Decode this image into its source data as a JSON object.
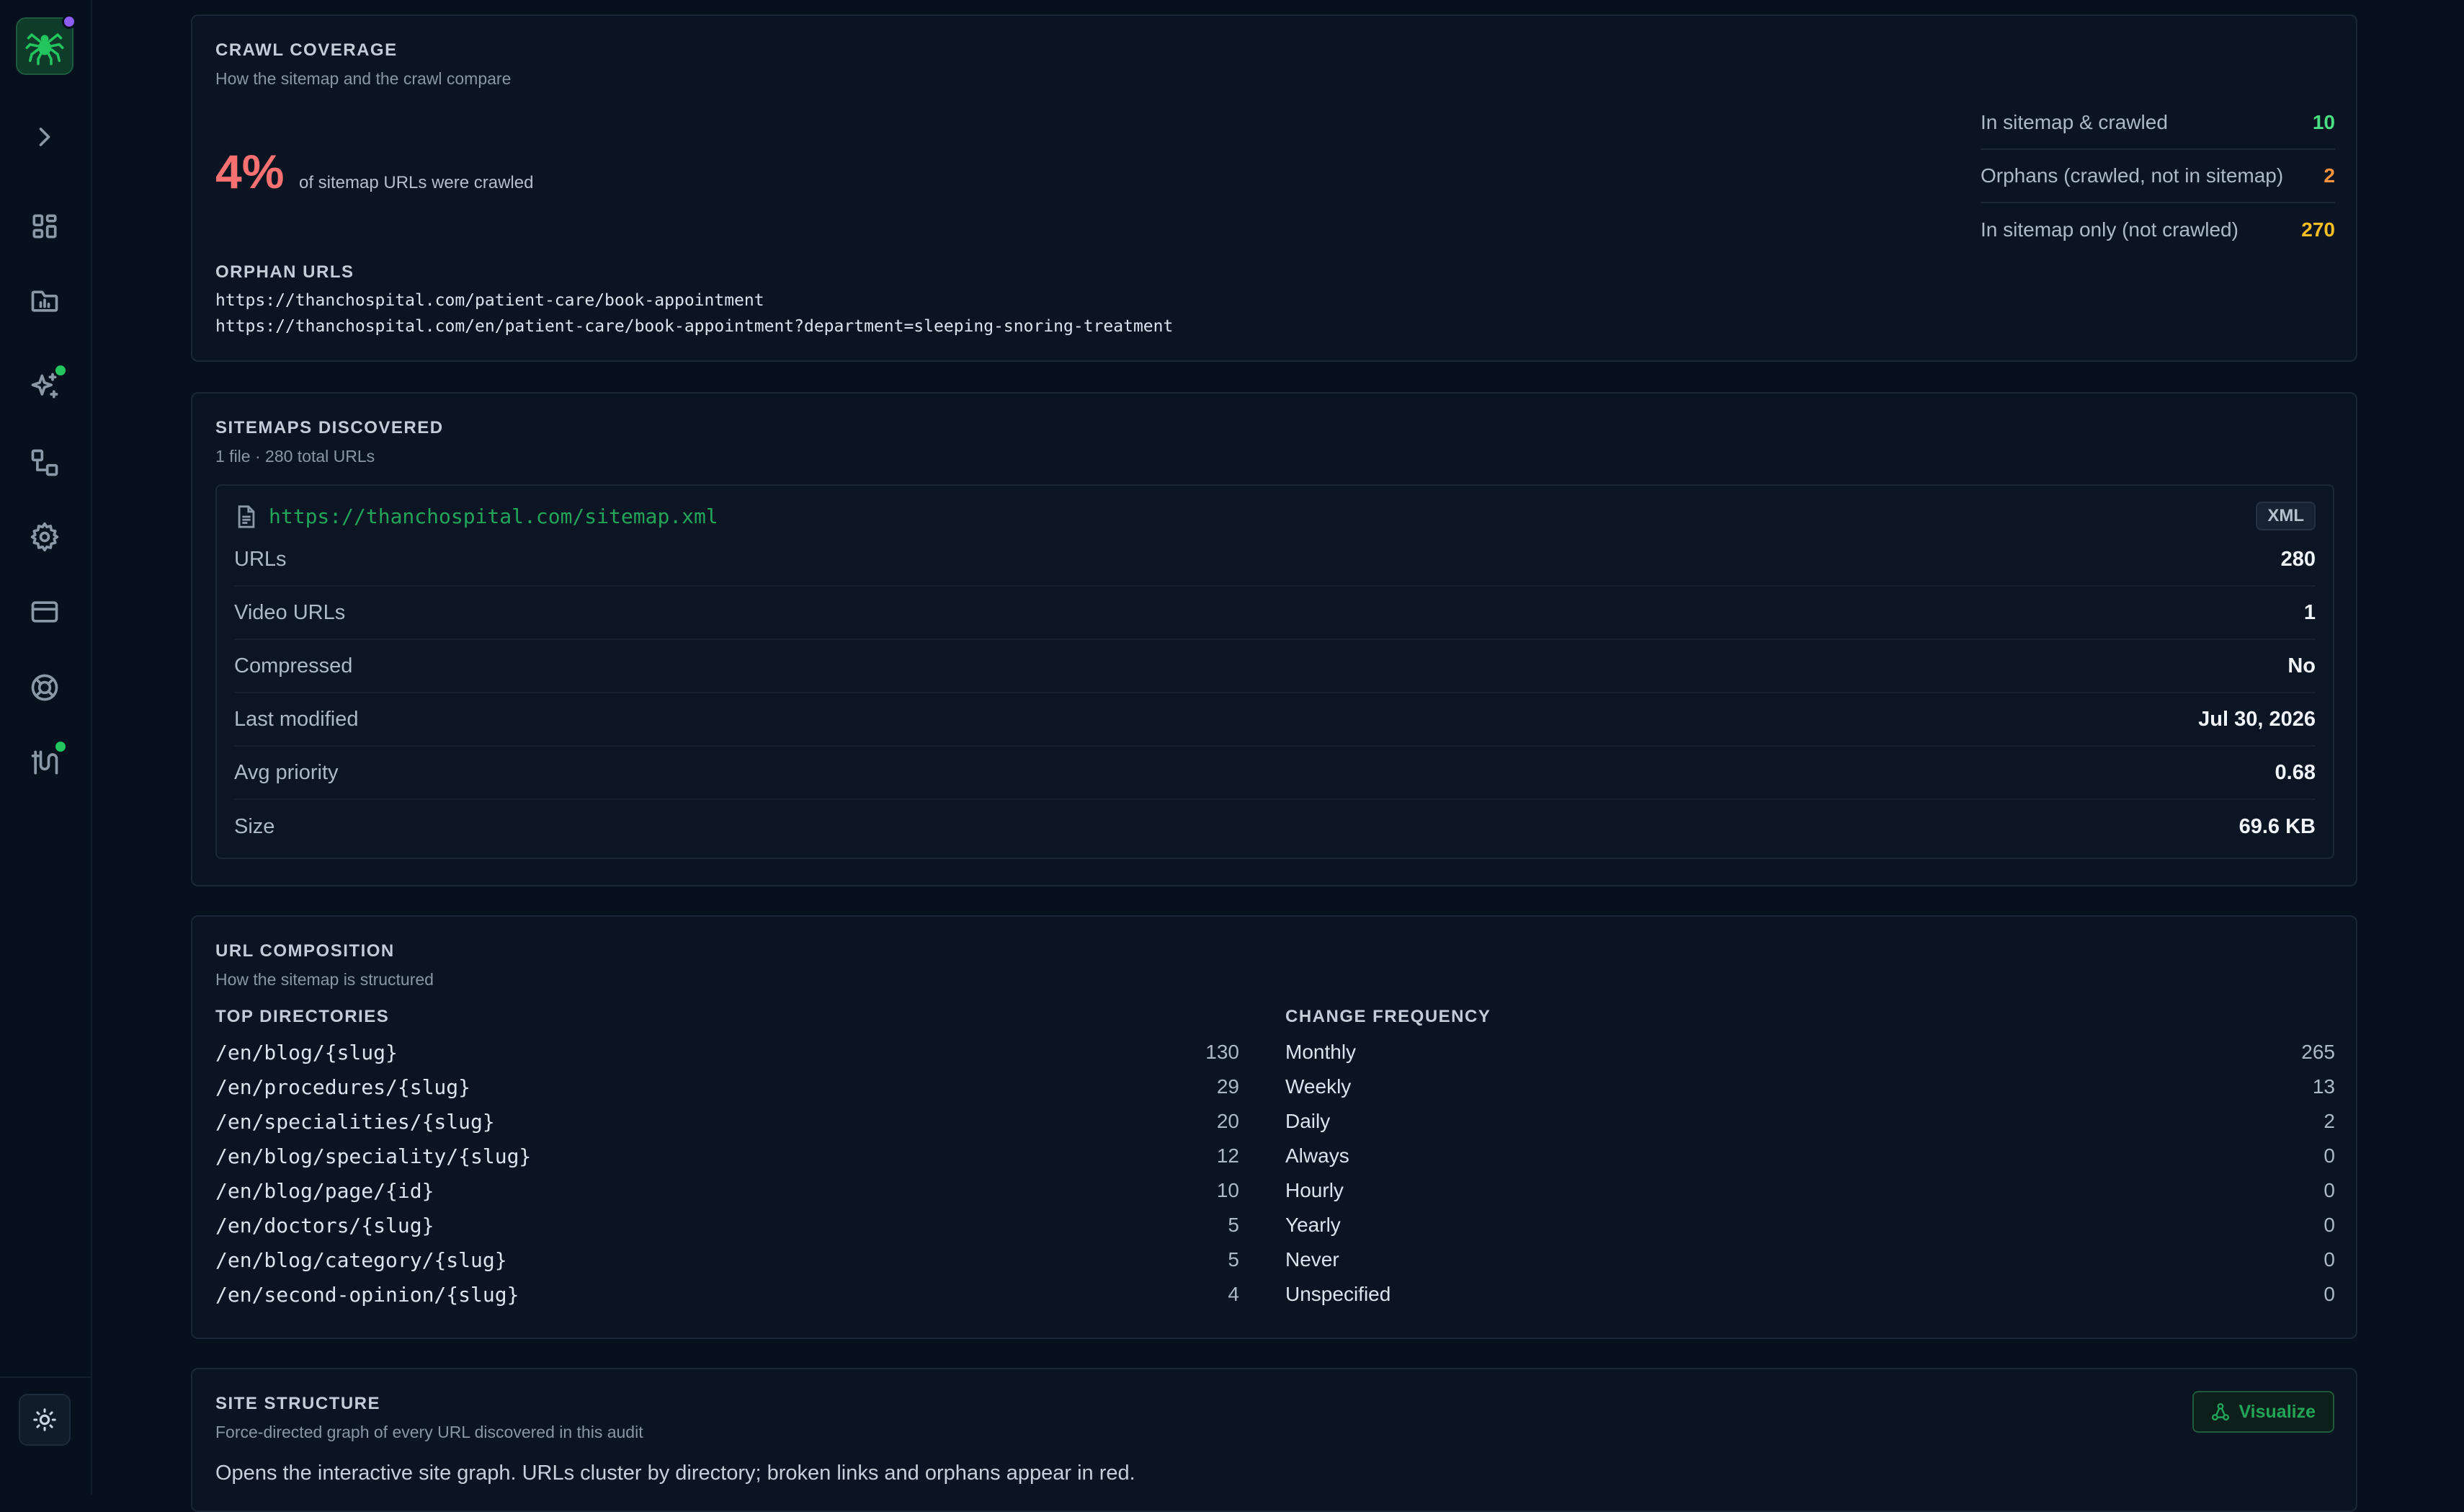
{
  "colors": {
    "accent_green": "#22a559",
    "red": "#f87171",
    "orange": "#fb923c",
    "yellow": "#fbbf24",
    "green_value": "#4ade80"
  },
  "sidebar": {
    "logo": "spider-logo",
    "items": [
      "chevron-right-icon",
      "dashboard-icon",
      "folder-chart-icon",
      "sparkles-icon",
      "workflow-icon",
      "gear-icon",
      "credit-card-icon",
      "lifebuoy-icon",
      "integrations-icon"
    ],
    "theme_toggle": "sun-icon"
  },
  "coverage": {
    "title": "CRAWL COVERAGE",
    "subtitle": "How the sitemap and the crawl compare",
    "percent": "4%",
    "percent_desc": "of sitemap URLs were crawled",
    "stats": [
      {
        "label": "In sitemap & crawled",
        "value": "10"
      },
      {
        "label": "Orphans (crawled, not in sitemap)",
        "value": "2"
      },
      {
        "label": "In sitemap only (not crawled)",
        "value": "270"
      }
    ],
    "orphan_title": "ORPHAN URLS",
    "orphans": [
      "https://thanchospital.com/patient-care/book-appointment",
      "https://thanchospital.com/en/patient-care/book-appointment?department=sleeping-snoring-treatment"
    ]
  },
  "sitemaps": {
    "title": "SITEMAPS DISCOVERED",
    "subtitle": "1 file · 280 total URLs",
    "file": {
      "url": "https://thanchospital.com/sitemap.xml",
      "badge": "XML",
      "rows": [
        {
          "label": "URLs",
          "value": "280"
        },
        {
          "label": "Video URLs",
          "value": "1"
        },
        {
          "label": "Compressed",
          "value": "No"
        },
        {
          "label": "Last modified",
          "value": "Jul 30, 2026"
        },
        {
          "label": "Avg priority",
          "value": "0.68"
        },
        {
          "label": "Size",
          "value": "69.6 KB"
        }
      ]
    }
  },
  "composition": {
    "title": "URL COMPOSITION",
    "subtitle": "How the sitemap is structured",
    "directories_title": "TOP DIRECTORIES",
    "directories": [
      {
        "path": "/en/blog/{slug}",
        "count": "130"
      },
      {
        "path": "/en/procedures/{slug}",
        "count": "29"
      },
      {
        "path": "/en/specialities/{slug}",
        "count": "20"
      },
      {
        "path": "/en/blog/speciality/{slug}",
        "count": "12"
      },
      {
        "path": "/en/blog/page/{id}",
        "count": "10"
      },
      {
        "path": "/en/doctors/{slug}",
        "count": "5"
      },
      {
        "path": "/en/blog/category/{slug}",
        "count": "5"
      },
      {
        "path": "/en/second-opinion/{slug}",
        "count": "4"
      }
    ],
    "frequency_title": "CHANGE FREQUENCY",
    "frequency": [
      {
        "label": "Monthly",
        "count": "265"
      },
      {
        "label": "Weekly",
        "count": "13"
      },
      {
        "label": "Daily",
        "count": "2"
      },
      {
        "label": "Always",
        "count": "0"
      },
      {
        "label": "Hourly",
        "count": "0"
      },
      {
        "label": "Yearly",
        "count": "0"
      },
      {
        "label": "Never",
        "count": "0"
      },
      {
        "label": "Unspecified",
        "count": "0"
      }
    ]
  },
  "structure": {
    "title": "SITE STRUCTURE",
    "subtitle": "Force-directed graph of every URL discovered in this audit",
    "button": "Visualize",
    "description": "Opens the interactive site graph. URLs cluster by directory; broken links and orphans appear in red."
  }
}
